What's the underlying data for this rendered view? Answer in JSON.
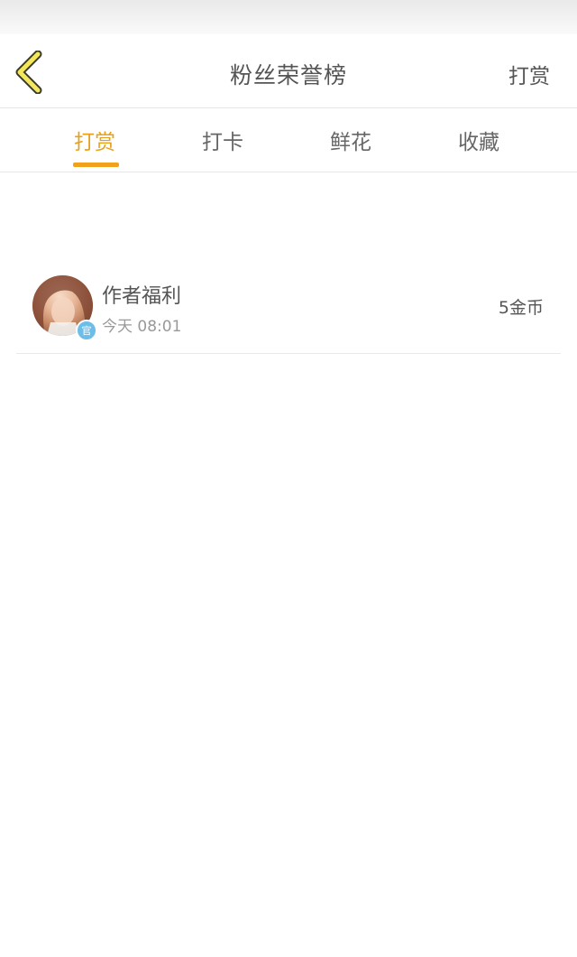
{
  "header": {
    "title": "粉丝荣誉榜",
    "action_label": "打赏"
  },
  "tabs": [
    {
      "label": "打赏",
      "active": true
    },
    {
      "label": "打卡",
      "active": false
    },
    {
      "label": "鲜花",
      "active": false
    },
    {
      "label": "收藏",
      "active": false
    }
  ],
  "list": [
    {
      "name": "作者福利",
      "time": "今天 08:01",
      "amount": "5金币",
      "badge": "官"
    }
  ],
  "colors": {
    "accent": "#f0a21a",
    "back_arrow_fill": "#f3e85a",
    "back_arrow_stroke": "#3a3a2a",
    "badge": "#6cbde8"
  }
}
